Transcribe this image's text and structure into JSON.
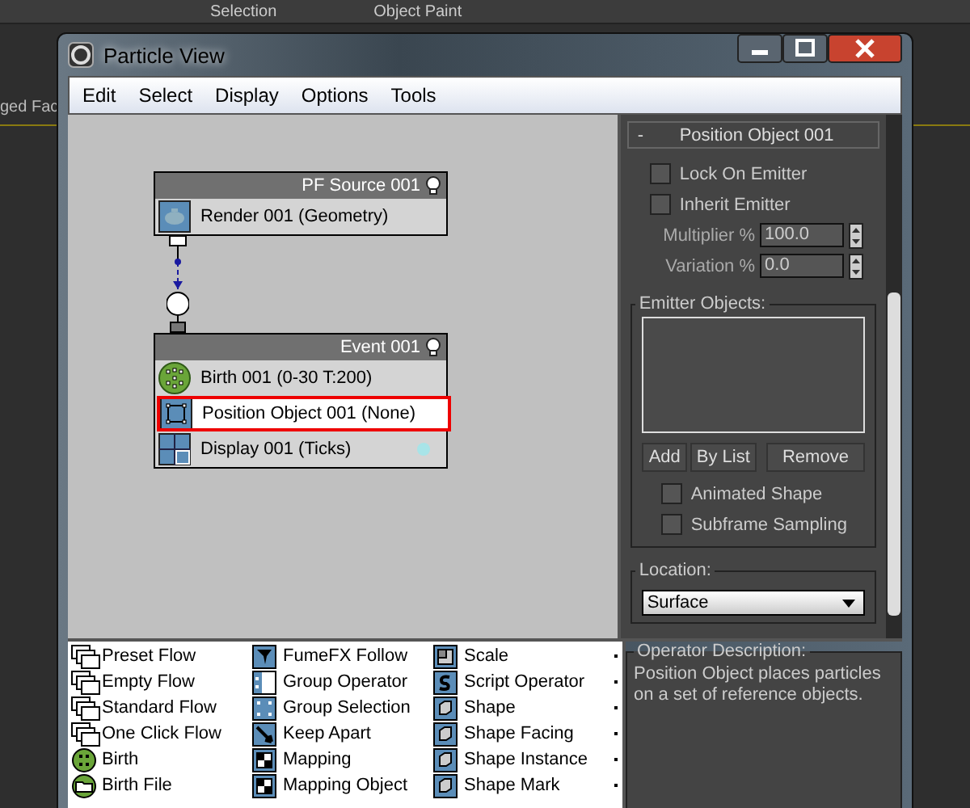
{
  "background": {
    "menu_items": [
      "Selection",
      "Object Paint"
    ],
    "side_text": "ged Fac"
  },
  "window": {
    "title": "Particle View"
  },
  "menu": [
    "Edit",
    "Select",
    "Display",
    "Options",
    "Tools"
  ],
  "graph": {
    "nodes": [
      {
        "title": "PF Source 001",
        "operators": [
          {
            "label": "Render 001 (Geometry)",
            "kind": "render",
            "selected": false
          }
        ]
      },
      {
        "title": "Event 001",
        "operators": [
          {
            "label": "Birth 001 (0-30 T:200)",
            "kind": "birth",
            "selected": false
          },
          {
            "label": "Position Object 001 (None)",
            "kind": "position",
            "selected": true
          },
          {
            "label": "Display 001 (Ticks)",
            "kind": "display",
            "selected": false
          }
        ]
      }
    ]
  },
  "rollout": {
    "title": "Position Object 001",
    "toggle": "-",
    "checks_top": [
      {
        "label": "Lock On Emitter",
        "checked": false
      },
      {
        "label": "Inherit Emitter",
        "checked": false
      }
    ],
    "spinners": [
      {
        "label": "Multiplier %",
        "value": "100.0"
      },
      {
        "label": "Variation %",
        "value": "0.0"
      }
    ],
    "emitter_group": "Emitter Objects:",
    "buttons": [
      "Add",
      "By List",
      "Remove"
    ],
    "checks_bottom": [
      {
        "label": "Animated Shape",
        "checked": false
      },
      {
        "label": "Subframe Sampling",
        "checked": false
      }
    ],
    "location_group": "Location:",
    "location_value": "Surface"
  },
  "depot": {
    "columns": [
      [
        {
          "label": "Preset Flow",
          "kind": "flow"
        },
        {
          "label": "Empty Flow",
          "kind": "flow"
        },
        {
          "label": "Standard Flow",
          "kind": "flow"
        },
        {
          "label": "One Click Flow",
          "kind": "flow"
        },
        {
          "label": "Birth",
          "kind": "birth"
        },
        {
          "label": "Birth File",
          "kind": "file"
        }
      ],
      [
        {
          "label": "FumeFX Follow",
          "kind": "fume"
        },
        {
          "label": "Group Operator",
          "kind": "group"
        },
        {
          "label": "Group Selection",
          "kind": "groupsel"
        },
        {
          "label": "Keep Apart",
          "kind": "keep"
        },
        {
          "label": "Mapping",
          "kind": "map"
        },
        {
          "label": "Mapping Object",
          "kind": "map"
        }
      ],
      [
        {
          "label": "Scale",
          "kind": "scale"
        },
        {
          "label": "Script Operator",
          "kind": "script"
        },
        {
          "label": "Shape",
          "kind": "shape"
        },
        {
          "label": "Shape Facing",
          "kind": "shape"
        },
        {
          "label": "Shape Instance",
          "kind": "shape"
        },
        {
          "label": "Shape Mark",
          "kind": "shape"
        }
      ]
    ]
  },
  "description": {
    "title": "Operator Description:",
    "text": "Position Object places particles on a set of reference objects."
  }
}
